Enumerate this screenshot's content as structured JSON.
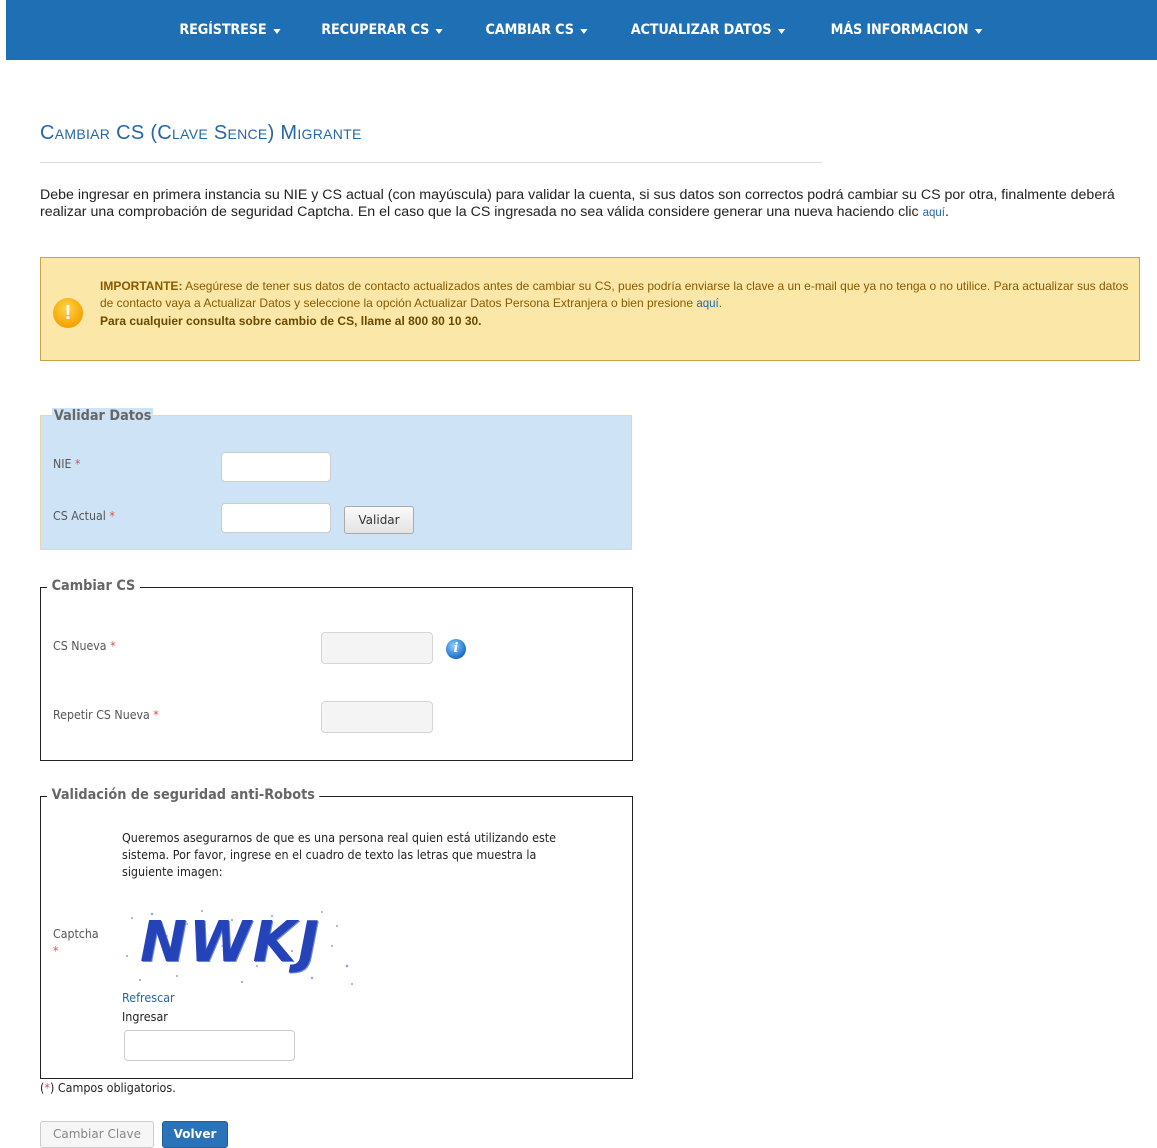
{
  "nav": {
    "items": [
      {
        "label": "REGÍSTRESE"
      },
      {
        "label": "RECUPERAR CS"
      },
      {
        "label": "CAMBIAR CS"
      },
      {
        "label": "ACTUALIZAR DATOS"
      },
      {
        "label": "MÁS INFORMACION"
      }
    ]
  },
  "page": {
    "title": "Cambiar CS (Clave Sence) Migrante",
    "intro_text": "Debe ingresar en primera instancia su NIE y CS actual (con mayúscula) para validar la cuenta, si sus datos son correctos podrá cambiar su CS por otra, finalmente deberá realizar una comprobación de seguridad Captcha. En el caso que la CS ingresada no sea válida considere generar una nueva haciendo clic",
    "intro_link": "aquí",
    "intro_end": "."
  },
  "alert": {
    "strong": "IMPORTANTE:",
    "text": "Asegúrese de tener sus datos de contacto actualizados antes de cambiar su CS, pues podría enviarse la clave a un e-mail que ya no tenga o no utilice. Para actualizar sus datos de contacto vaya a Actualizar Datos y seleccione la opción Actualizar Datos Persona Extranjera o bien presione",
    "link": "aquí",
    "end": ".",
    "phone_line": "Para cualquier consulta sobre cambio de CS, llame al 800 80 10 30.",
    "icon": "warning-icon",
    "color": "#fbe8a8"
  },
  "validar": {
    "legend": "Validar Datos",
    "nie_label": "NIE",
    "cs_label": "CS Actual",
    "button": "Validar",
    "required_mark": "*"
  },
  "cambiar": {
    "legend": "Cambiar CS",
    "new_label": "CS Nueva",
    "repeat_label": "Repetir CS Nueva",
    "required_mark": "*",
    "info_icon": "info-icon"
  },
  "captcha": {
    "legend": "Validación de seguridad anti-Robots",
    "text": "Queremos asegurarnos de que es una persona real quien está utilizando este sistema. Por favor, ingrese en el cuadro de texto las letras que muestra la siguiente imagen:",
    "label": "Captcha",
    "required_mark": "*",
    "image_text": "NWKJ",
    "refresh": "Refrescar",
    "input_label": "Ingresar"
  },
  "footer": {
    "required_note_mark": "*",
    "required_note": "Campos obligatorios.",
    "cambiar_button": "Cambiar Clave",
    "volver_button": "Volver"
  },
  "colors": {
    "nav": "#1e6fb3",
    "title": "#2567a8",
    "panel_blue": "#cfe3f6"
  }
}
